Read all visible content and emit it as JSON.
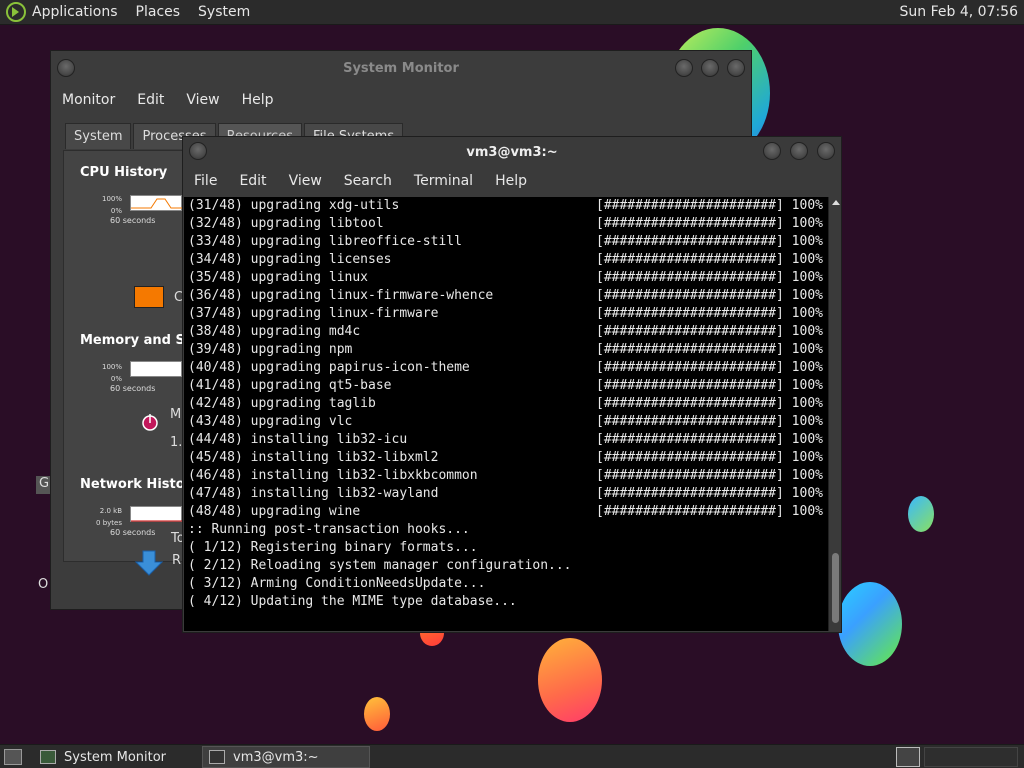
{
  "top_panel": {
    "menus": [
      "Applications",
      "Places",
      "System"
    ],
    "clock": "Sun Feb  4, 07:56"
  },
  "system_monitor": {
    "title": "System Monitor",
    "menus": [
      "Monitor",
      "Edit",
      "View",
      "Help"
    ],
    "tabs": [
      "System",
      "Processes",
      "Resources",
      "File Systems"
    ],
    "active_tab": "Resources",
    "cpu": {
      "heading": "CPU History",
      "axis_top": "100%",
      "axis_bottom": "0%",
      "seconds": "60 seconds",
      "label_partial": "C",
      "swatch_color": "#f57900"
    },
    "memory": {
      "heading": "Memory and Swa",
      "axis_top": "100%",
      "axis_bottom": "0%",
      "seconds": "60 seconds",
      "label_partial": "M",
      "value_partial": "1."
    },
    "network": {
      "heading": "Network History",
      "axis_top": "2.0 kB",
      "axis_bottom": "0 bytes",
      "seconds": "60 seconds",
      "label_partial": "R",
      "total_partial": "To"
    }
  },
  "terminal": {
    "title": "vm3@vm3:~",
    "menus": [
      "File",
      "Edit",
      "View",
      "Search",
      "Terminal",
      "Help"
    ],
    "lines": [
      {
        "text": "(31/48) upgrading xdg-utils",
        "bar": "[######################] 100%"
      },
      {
        "text": "(32/48) upgrading libtool",
        "bar": "[######################] 100%"
      },
      {
        "text": "(33/48) upgrading libreoffice-still",
        "bar": "[######################] 100%"
      },
      {
        "text": "(34/48) upgrading licenses",
        "bar": "[######################] 100%"
      },
      {
        "text": "(35/48) upgrading linux",
        "bar": "[######################] 100%"
      },
      {
        "text": "(36/48) upgrading linux-firmware-whence",
        "bar": "[######################] 100%"
      },
      {
        "text": "(37/48) upgrading linux-firmware",
        "bar": "[######################] 100%"
      },
      {
        "text": "(38/48) upgrading md4c",
        "bar": "[######################] 100%"
      },
      {
        "text": "(39/48) upgrading npm",
        "bar": "[######################] 100%"
      },
      {
        "text": "(40/48) upgrading papirus-icon-theme",
        "bar": "[######################] 100%"
      },
      {
        "text": "(41/48) upgrading qt5-base",
        "bar": "[######################] 100%"
      },
      {
        "text": "(42/48) upgrading taglib",
        "bar": "[######################] 100%"
      },
      {
        "text": "(43/48) upgrading vlc",
        "bar": "[######################] 100%"
      },
      {
        "text": "(44/48) installing lib32-icu",
        "bar": "[######################] 100%"
      },
      {
        "text": "(45/48) installing lib32-libxml2",
        "bar": "[######################] 100%"
      },
      {
        "text": "(46/48) installing lib32-libxkbcommon",
        "bar": "[######################] 100%"
      },
      {
        "text": "(47/48) installing lib32-wayland",
        "bar": "[######################] 100%"
      },
      {
        "text": "(48/48) upgrading wine",
        "bar": "[######################] 100%"
      },
      {
        "text": ":: Running post-transaction hooks...",
        "bar": ""
      },
      {
        "text": "( 1/12) Registering binary formats...",
        "bar": ""
      },
      {
        "text": "( 2/12) Reloading system manager configuration...",
        "bar": ""
      },
      {
        "text": "( 3/12) Arming ConditionNeedsUpdate...",
        "bar": ""
      },
      {
        "text": "( 4/12) Updating the MIME type database...",
        "bar": ""
      }
    ]
  },
  "desktop": {
    "label_g": "G",
    "label_o": "O"
  },
  "taskbar": {
    "items": [
      "System Monitor",
      "vm3@vm3:~"
    ],
    "active_item": "vm3@vm3:~"
  }
}
